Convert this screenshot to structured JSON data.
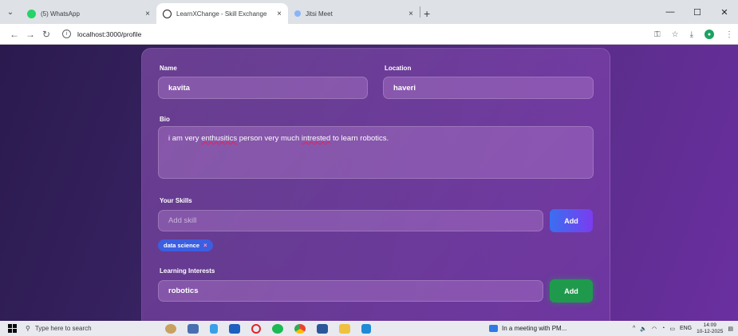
{
  "browser": {
    "tabs": [
      {
        "title": "(5) WhatsApp",
        "active": false,
        "icon": "whatsapp-icon",
        "color": "#25d366"
      },
      {
        "title": "LearnXChange - Skill Exchange",
        "active": true,
        "icon": "globe-icon",
        "color": "#202124"
      },
      {
        "title": "Jitsi Meet",
        "active": false,
        "icon": "jitsi-icon",
        "color": "#8ab4f8"
      }
    ],
    "close_glyph": "×",
    "new_tab_glyph": "+",
    "url": "localhost:3000/profile"
  },
  "profile": {
    "name_label": "Name",
    "name_value": "kavita",
    "location_label": "Location",
    "location_value": "haveri",
    "bio_label": "Bio",
    "bio_parts": [
      "i am very ",
      "enthusitics",
      " person very much ",
      "intrested",
      " to learn robotics."
    ],
    "skills_label": "Your Skills",
    "skill_placeholder": "Add skill",
    "skill_add_label": "Add",
    "skills": [
      {
        "label": "data science",
        "remove": "×"
      }
    ],
    "interests_label": "Learning Interests",
    "interest_value": "robotics",
    "interest_add_label": "Add"
  },
  "taskbar": {
    "search_placeholder": "Type here to search",
    "meeting_text": "In a meeting with PM...",
    "language": "ENG",
    "time": "14:09",
    "date": "10-12-2025"
  },
  "colors": {
    "accent_blue": "#3a6ff0",
    "accent_green": "#1f9a4d",
    "chip": "#3b5fe0"
  }
}
